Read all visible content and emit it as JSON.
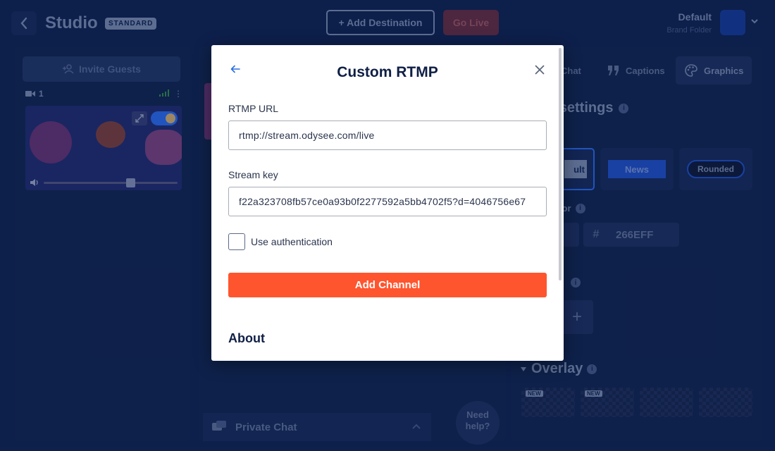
{
  "topbar": {
    "title": "Studio",
    "plan_badge": "STANDARD",
    "add_destination_label": "+ Add Destination",
    "go_live_label": "Go Live",
    "brand_name": "Default",
    "brand_subtitle": "Brand Folder"
  },
  "left_panel": {
    "invite_label": "Invite Guests",
    "camera_count": "1"
  },
  "center_panel": {
    "private_chat_label": "Private Chat",
    "need_help_line1": "Need",
    "need_help_line2": "help?"
  },
  "right_panel": {
    "tabs": [
      {
        "label": "Chat"
      },
      {
        "label": "Captions"
      },
      {
        "label": "Graphics",
        "active": true
      }
    ],
    "heading": "d settings",
    "themes": [
      {
        "label": "ult"
      },
      {
        "label": "News"
      },
      {
        "label": "Rounded"
      }
    ],
    "color_label": "olor",
    "color_hex": "266EFF",
    "overlay_heading": "Overlay",
    "new_tag": "NEW"
  },
  "modal": {
    "title": "Custom RTMP",
    "rtmp_url_label": "RTMP URL",
    "rtmp_url_value": "rtmp://stream.odysee.com/live",
    "stream_key_label": "Stream key",
    "stream_key_value": "f22a323708fb57ce0a93b0f2277592a5bb4702f5?d=4046756e67",
    "use_auth_label": "Use authentication",
    "use_auth_checked": false,
    "submit_label": "Add Channel",
    "about_heading": "About"
  },
  "colors": {
    "accent": "#ff552e",
    "link_blue": "#2b6fe0",
    "app_background": "#0f2250",
    "brand_color": "#266EFF"
  }
}
